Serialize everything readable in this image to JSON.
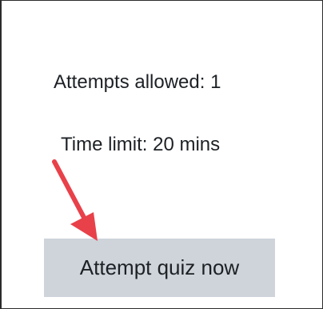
{
  "quiz": {
    "attempts_allowed": "Attempts allowed: 1",
    "time_limit": "Time limit: 20 mins",
    "attempt_button_label": "Attempt quiz now"
  },
  "annotation": {
    "arrow_color": "#e8414a"
  }
}
